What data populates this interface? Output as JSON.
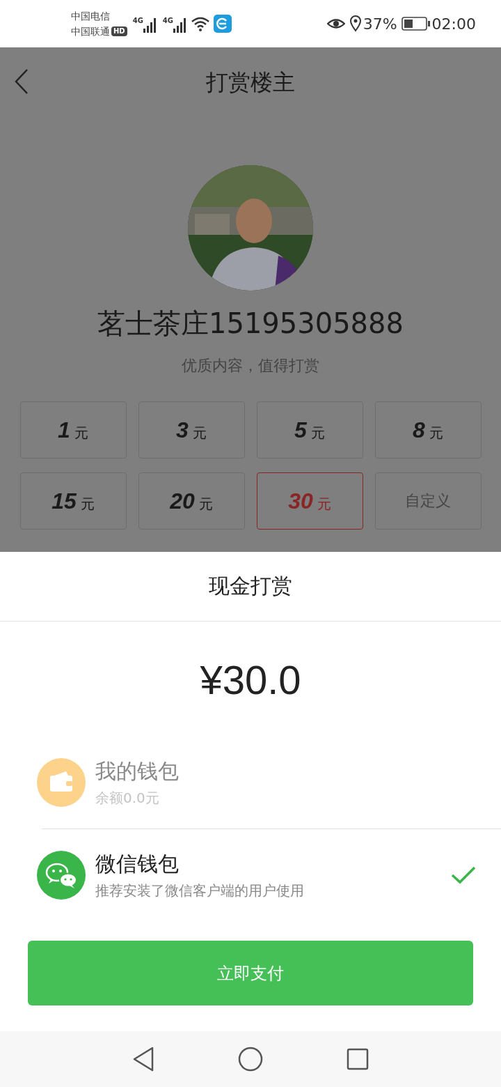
{
  "status_bar": {
    "carriers": [
      "中国电信",
      "中国联通"
    ],
    "hd_badge": "HD",
    "network_labels": [
      "4G",
      "4G"
    ],
    "battery_percent": "37%",
    "time": "02:00"
  },
  "header": {
    "title": "打赏楼主"
  },
  "author": {
    "name": "茗士茶庄15195305888",
    "tagline": "优质内容，值得打赏"
  },
  "amount_options": [
    {
      "kind": "amount",
      "value": "1",
      "unit": "元",
      "selected": false
    },
    {
      "kind": "amount",
      "value": "3",
      "unit": "元",
      "selected": false
    },
    {
      "kind": "amount",
      "value": "5",
      "unit": "元",
      "selected": false
    },
    {
      "kind": "amount",
      "value": "8",
      "unit": "元",
      "selected": false
    },
    {
      "kind": "amount",
      "value": "15",
      "unit": "元",
      "selected": false
    },
    {
      "kind": "amount",
      "value": "20",
      "unit": "元",
      "selected": false
    },
    {
      "kind": "amount",
      "value": "30",
      "unit": "元",
      "selected": true
    },
    {
      "kind": "custom",
      "label": "自定义",
      "selected": false
    }
  ],
  "sheet": {
    "title": "现金打赏",
    "amount": "¥30.0",
    "payment_methods": [
      {
        "kind": "wallet",
        "name": "我的钱包",
        "note": "余额0.0元",
        "disabled": true,
        "selected": false
      },
      {
        "kind": "wechat",
        "name": "微信钱包",
        "note": "推荐安装了微信客户端的用户使用",
        "disabled": false,
        "selected": true
      }
    ],
    "pay_button": "立即支付"
  }
}
